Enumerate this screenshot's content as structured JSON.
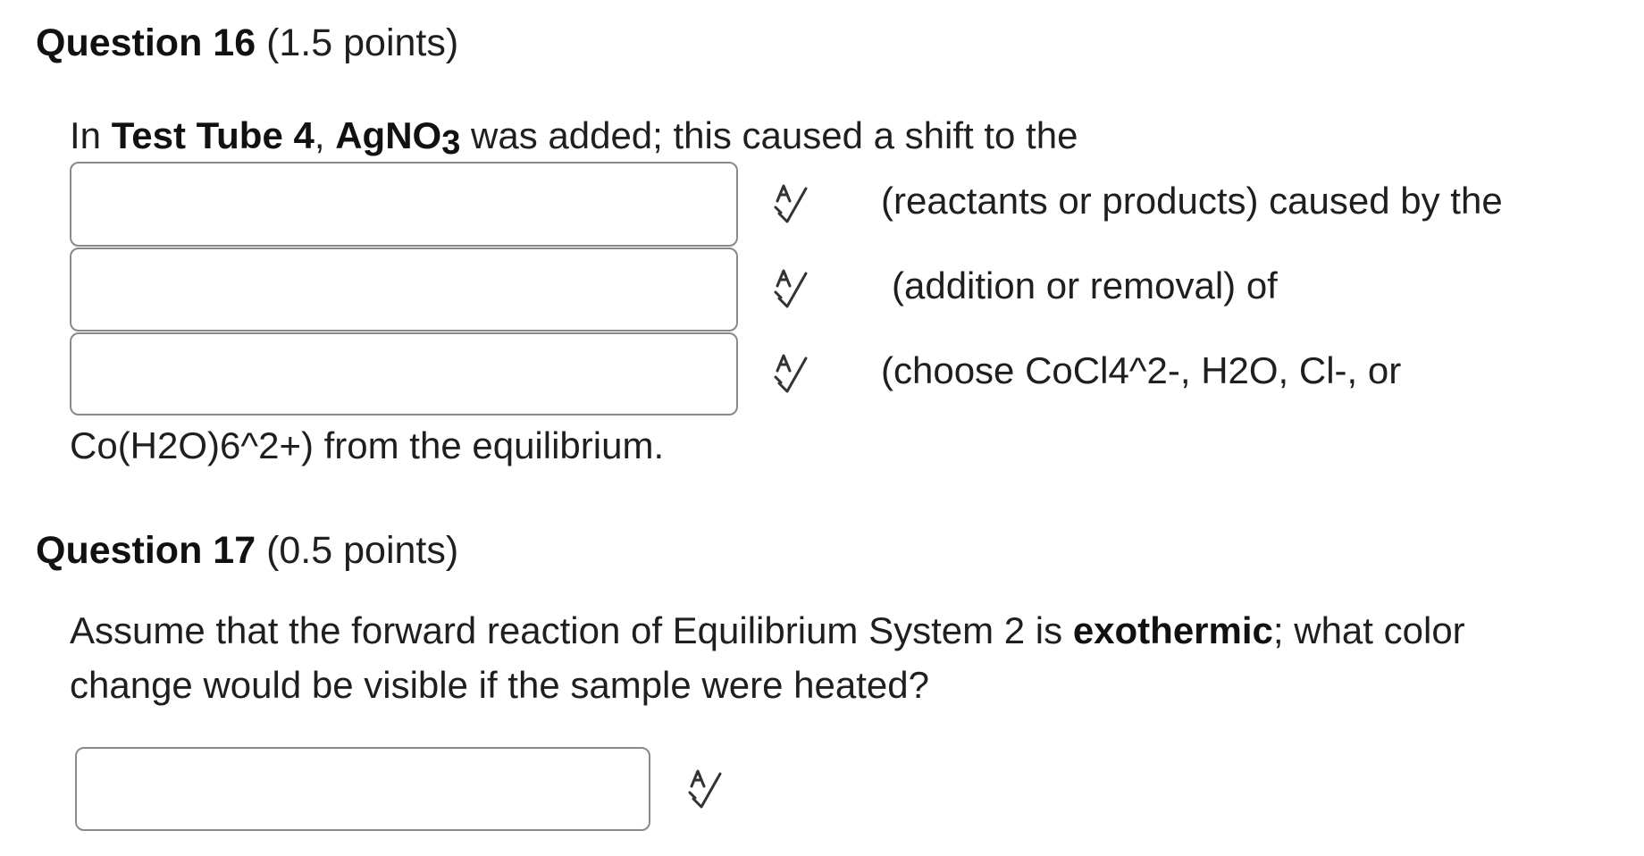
{
  "question16": {
    "number_label": "Question 16",
    "points_label": "(1.5 points)",
    "prompt": {
      "part1": "In ",
      "test_tube": "Test Tube 4",
      "part2": ", ",
      "formula_main": "AgNO",
      "formula_sub": "3",
      "part3": " was added; this caused a shift to the"
    },
    "blanks": [
      {
        "value": "",
        "placeholder": "",
        "hint": "(reactants or products) caused by the",
        "icon": "spellcheck-icon"
      },
      {
        "value": "",
        "placeholder": "",
        "hint": "(addition or removal) of",
        "icon": "spellcheck-icon"
      },
      {
        "value": "",
        "placeholder": "",
        "hint": "(choose CoCl4^2-, H2O, Cl-, or",
        "icon": "spellcheck-icon"
      }
    ],
    "trailing_text": "Co(H2O)6^2+) from the equilibrium."
  },
  "question17": {
    "number_label": "Question 17",
    "points_label": "(0.5 points)",
    "prompt": {
      "line1_part1": "Assume that the forward reaction of Equilibrium System 2 is ",
      "line1_bold": "exothermic",
      "line1_part2": "; what color",
      "line2": "change would be visible if the sample were heated?"
    },
    "answer": {
      "value": "",
      "placeholder": "",
      "icon": "spellcheck-icon"
    }
  },
  "colors": {
    "text": "#1f1f1f",
    "border": "#8a8a8a",
    "icon": "#333333"
  }
}
